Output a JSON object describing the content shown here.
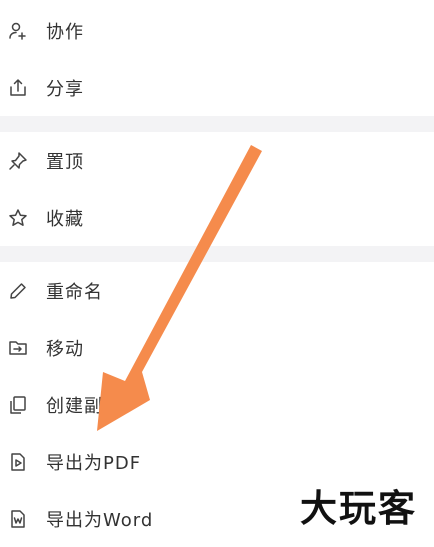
{
  "menu": {
    "group1": [
      {
        "label": "协作",
        "icon": "collaborate-icon"
      },
      {
        "label": "分享",
        "icon": "share-icon"
      }
    ],
    "group2": [
      {
        "label": "置顶",
        "icon": "pin-icon"
      },
      {
        "label": "收藏",
        "icon": "star-icon"
      }
    ],
    "group3": [
      {
        "label": "重命名",
        "icon": "pencil-icon"
      },
      {
        "label": "移动",
        "icon": "folder-move-icon"
      },
      {
        "label": "创建副",
        "icon": "copy-icon"
      },
      {
        "label": "导出为PDF",
        "icon": "pdf-file-icon"
      },
      {
        "label": "导出为Word",
        "icon": "word-file-icon"
      }
    ]
  },
  "overlay": {
    "arrow_color": "#f58b4c",
    "watermark": "大玩客"
  },
  "colors": {
    "text": "#333333",
    "separator": "#f3f3f5",
    "icon": "#444444"
  }
}
